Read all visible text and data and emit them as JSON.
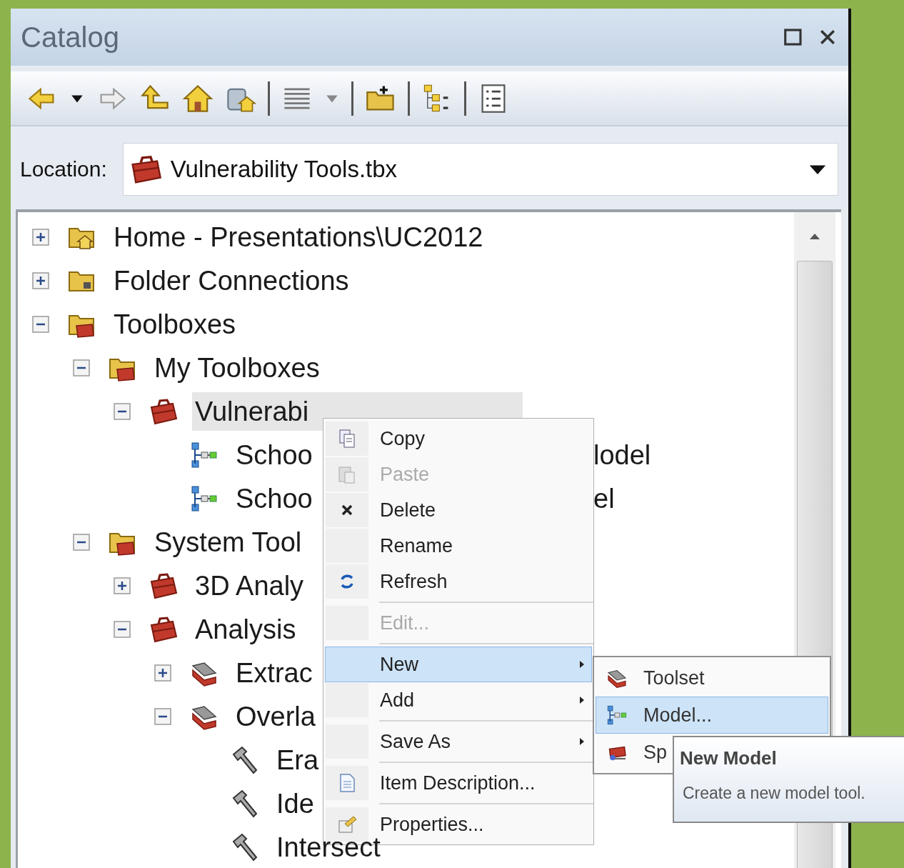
{
  "window": {
    "title": "Catalog"
  },
  "location": {
    "label": "Location:",
    "value": "Vulnerability Tools.tbx"
  },
  "tree": [
    {
      "label": "Home - Presentations\\UC2012",
      "kind": "folder_home",
      "expanded": false,
      "selected": false
    },
    {
      "label": "Folder Connections",
      "kind": "folder_link",
      "expanded": false,
      "selected": false
    },
    {
      "label": "Toolboxes",
      "kind": "folder_toolbox",
      "expanded": true,
      "selected": false,
      "children": [
        {
          "label": "My Toolboxes",
          "kind": "folder_toolbox",
          "expanded": true,
          "selected": false,
          "children": [
            {
              "label": "Vulnerabi",
              "kind": "toolbox",
              "expanded": true,
              "selected": true,
              "children": [
                {
                  "label": "Schoo",
                  "tail": "lodel",
                  "kind": "model",
                  "selected": false
                },
                {
                  "label": "Schoo",
                  "tail": "el",
                  "kind": "model",
                  "selected": false
                }
              ]
            }
          ]
        },
        {
          "label": "System Tool",
          "kind": "folder_toolbox",
          "expanded": true,
          "selected": false,
          "children": [
            {
              "label": "3D Analy",
              "kind": "toolbox",
              "expanded": false,
              "selected": false
            },
            {
              "label": "Analysis",
              "kind": "toolbox",
              "expanded": true,
              "selected": false,
              "children": [
                {
                  "label": "Extrac",
                  "kind": "toolset",
                  "expanded": false,
                  "selected": false
                },
                {
                  "label": "Overla",
                  "kind": "toolset",
                  "expanded": true,
                  "selected": false,
                  "children": [
                    {
                      "label": "Era",
                      "kind": "tool",
                      "selected": false
                    },
                    {
                      "label": "Ide",
                      "kind": "tool",
                      "selected": false
                    },
                    {
                      "label": "Intersect",
                      "kind": "tool",
                      "selected": false
                    }
                  ]
                }
              ]
            }
          ]
        }
      ]
    }
  ],
  "context_menu": [
    {
      "kind": "item",
      "label": "Copy",
      "disabled": false,
      "selected": false,
      "has_submenu": false
    },
    {
      "kind": "item",
      "label": "Paste",
      "disabled": true,
      "selected": false,
      "has_submenu": false
    },
    {
      "kind": "item",
      "label": "Delete",
      "disabled": false,
      "selected": false,
      "has_submenu": false
    },
    {
      "kind": "item",
      "label": "Rename",
      "disabled": false,
      "selected": false,
      "has_submenu": false
    },
    {
      "kind": "item",
      "label": "Refresh",
      "disabled": false,
      "selected": false,
      "has_submenu": false
    },
    {
      "kind": "separator"
    },
    {
      "kind": "item",
      "label": "Edit...",
      "disabled": true,
      "selected": false,
      "has_submenu": false
    },
    {
      "kind": "separator"
    },
    {
      "kind": "item",
      "label": "New",
      "disabled": false,
      "selected": true,
      "has_submenu": true
    },
    {
      "kind": "item",
      "label": "Add",
      "disabled": false,
      "selected": false,
      "has_submenu": true
    },
    {
      "kind": "separator"
    },
    {
      "kind": "item",
      "label": "Save As",
      "disabled": false,
      "selected": false,
      "has_submenu": true
    },
    {
      "kind": "separator"
    },
    {
      "kind": "item",
      "label": "Item Description...",
      "disabled": false,
      "selected": false,
      "has_submenu": false
    },
    {
      "kind": "separator"
    },
    {
      "kind": "item",
      "label": "Properties...",
      "disabled": false,
      "selected": false,
      "has_submenu": false
    }
  ],
  "submenu": [
    {
      "label": "Toolset",
      "selected": false
    },
    {
      "label": "Model...",
      "selected": true
    },
    {
      "label": "Sp",
      "selected": false
    }
  ],
  "tooltip": {
    "title": "New Model",
    "text": "Create a new model tool."
  }
}
